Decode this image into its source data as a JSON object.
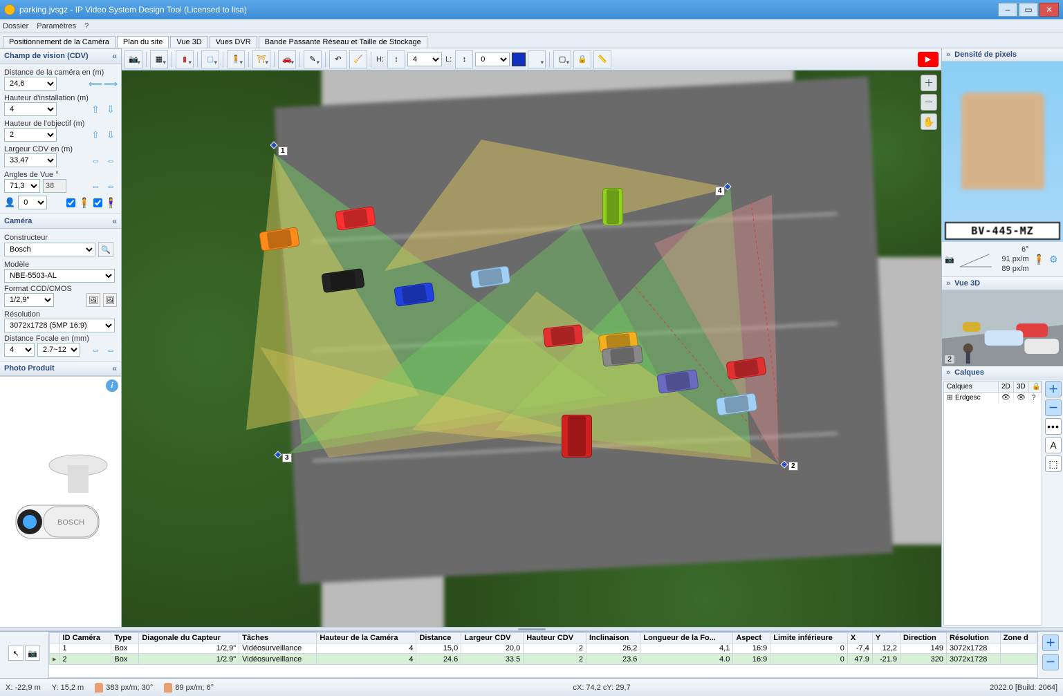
{
  "title": "parking.jvsgz - IP Video System Design Tool (Licensed to lisa)",
  "menu": {
    "dossier": "Dossier",
    "params": "Paramètres",
    "help": "?"
  },
  "tabs": {
    "pos": "Positionnement de la Caméra",
    "plan": "Plan du site",
    "vue3d": "Vue 3D",
    "dvr": "Vues DVR",
    "bande": "Bande Passante Réseau et Taille de Stockage"
  },
  "cdv": {
    "header": "Champ de vision (CDV)",
    "dist_label": "Distance de la caméra en (m)",
    "dist_val": "24,6",
    "hinst_label": "Hauteur d'installation (m)",
    "hinst_val": "4",
    "hobj_label": "Hauteur de l'objectif (m)",
    "hobj_val": "2",
    "larg_label": "Largeur CDV en (m)",
    "larg_val": "33,47",
    "ang_label": "Angles de Vue °",
    "ang_h": "71,3",
    "ang_v": "38",
    "people_val": "0"
  },
  "camera": {
    "header": "Caméra",
    "constr_label": "Constructeur",
    "constr_val": "Bosch",
    "model_label": "Modèle",
    "model_val": "NBE-5503-AL",
    "format_label": "Format CCD/CMOS",
    "format_val": "1/2,9''",
    "res_label": "Résolution",
    "res_val": "3072x1728 (5MP 16:9)",
    "focal_label": "Distance Focale en (mm)",
    "focal_min": "4",
    "focal_range": "2.7~12"
  },
  "photo": {
    "header": "Photo Produit"
  },
  "toolbar": {
    "H": "H:",
    "H_val": "4",
    "L": "L:",
    "L_val": "0"
  },
  "canvas": {
    "cam1": "1",
    "cam2": "2",
    "cam3": "3",
    "cam4": "4"
  },
  "rp": {
    "dens_header": "Densité de pixels",
    "plate": "BV-445-MZ",
    "angle": "6°",
    "pxm1": "91 px/m",
    "pxm2": "89 px/m",
    "vue3d_header": "Vue 3D",
    "vue3d_badge": "2",
    "calques_header": "Calques",
    "col_calques": "Calques",
    "col_2d": "2D",
    "col_3d": "3D",
    "col_lock": "🔒",
    "layer_name": "Erdgesc",
    "eye": "👁",
    "q": "?"
  },
  "tablecols": {
    "id": "ID Caméra",
    "type": "Type",
    "diag": "Diagonale du Capteur",
    "taches": "Tâches",
    "haut": "Hauteur de la Caméra",
    "dist": "Distance",
    "largcdv": "Largeur CDV",
    "hautcdv": "Hauteur CDV",
    "incl": "Inclinaison",
    "long": "Longueur de la Fo...",
    "aspect": "Aspect",
    "limite": "Limite inférieure",
    "x": "X",
    "y": "Y",
    "dir": "Direction",
    "res": "Résolution",
    "zone": "Zone d"
  },
  "rows": [
    {
      "id": "1",
      "type": "Box",
      "diag": "1/2,9\"",
      "taches": "Vidéosurveillance",
      "haut": "4",
      "dist": "15,0",
      "larg": "20,0",
      "hcdv": "2",
      "incl": "26,2",
      "long": "4,1",
      "aspect": "16:9",
      "lim": "0",
      "x": "-7,4",
      "y": "12,2",
      "dir": "149",
      "res": "3072x1728"
    },
    {
      "id": "2",
      "type": "Box",
      "diag": "1/2.9\"",
      "taches": "Vidéosurveillance",
      "haut": "4",
      "dist": "24.6",
      "larg": "33.5",
      "hcdv": "2",
      "incl": "23.6",
      "long": "4.0",
      "aspect": "16:9",
      "lim": "0",
      "x": "47.9",
      "y": "-21.9",
      "dir": "320",
      "res": "3072x1728"
    }
  ],
  "status": {
    "x": "X: -22,9 m",
    "y": "Y: 15,2 m",
    "p1": "383 px/m; 30°",
    "p2": "89 px/m; 6°",
    "cxy": "cX: 74,2 cY: 29,7",
    "build": "2022.0 [Build: 2064]"
  }
}
